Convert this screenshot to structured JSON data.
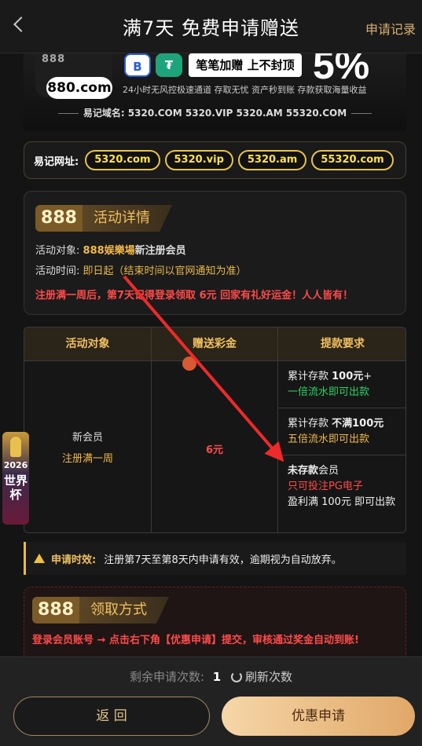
{
  "header": {
    "title": "满7天 免费申请赠送",
    "record_link": "申请记录"
  },
  "banner": {
    "logo_top": "888",
    "logo_domain": "880.com",
    "coin_b": "B",
    "coin_t": "₮",
    "slogan": "笔笔加赠 上不封顶",
    "percent": "5%",
    "subtitle": "24小时无风控极速通道  存取无忧  资产秒到账  存款获取海量收益",
    "domains": "易记域名: 5320.COM  5320.VIP  5320.AM  55320.COM"
  },
  "url_bar": {
    "label": "易记网址:",
    "urls": [
      "5320.com",
      "5320.vip",
      "5320.am",
      "55320.com"
    ]
  },
  "details": {
    "badge_num": "888",
    "badge_label": "活动详情",
    "target_label": "活动对象:",
    "target_brand": "888娱樂場",
    "target_value": "新注册会员",
    "time_label": "活动时间:",
    "time_value": "即日起（结束时间以官网通知为准）",
    "highlight": "注册满一周后，第7天记得登录领取 6元 回家有礼好运金！人人皆有！"
  },
  "table": {
    "headers": [
      "活动对象",
      "赠送彩金",
      "提款要求"
    ],
    "target_line1": "新会员",
    "target_line2": "注册满一周",
    "bonus": "6元",
    "req1_a": "累计存款 ",
    "req1_b": "100元",
    "req1_c": "+",
    "req1_d": "一倍流水即可出款",
    "req2_a": "累计存款 ",
    "req2_b": "不满100元",
    "req2_c": "五倍流水即可出款",
    "req3_a": "未存款",
    "req3_b": "会员",
    "req3_c": "只可投注PG电子",
    "req3_d": "盈利满 100元 即可出款"
  },
  "notice": {
    "label": "申请时效:",
    "text": "注册第7天至第8天内申请有效，逾期视为自动放弃。"
  },
  "claim": {
    "badge_num": "888",
    "badge_label": "领取方式",
    "text": "登录会员账号 → 点击右下角【优惠申请】提交，审核通过奖金自动到账!"
  },
  "float": {
    "year": "2026",
    "label": "世界杯"
  },
  "bottom": {
    "remain_label": "剩余申请次数:",
    "remain_count": "1",
    "refresh_label": "刷新次数",
    "back_label": "返 回",
    "apply_label": "优惠申请"
  },
  "colors": {
    "accent_gold": "#d8b071",
    "highlight_red": "#ff4a4a",
    "green": "#2ed162",
    "arrow_red": "#ee2a2a"
  }
}
